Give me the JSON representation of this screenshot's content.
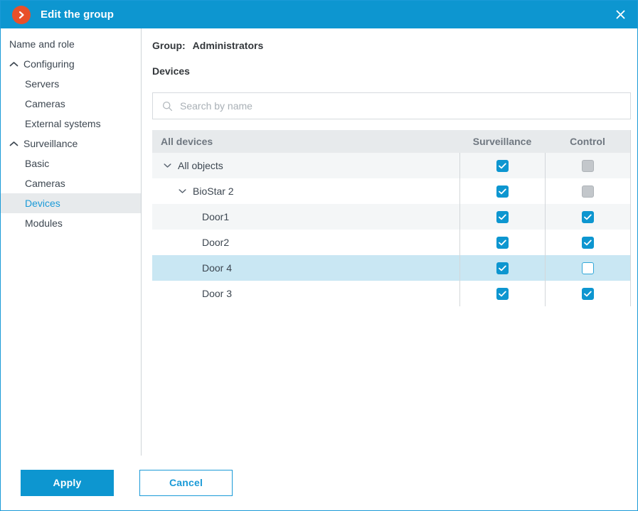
{
  "window": {
    "title": "Edit the group",
    "app_icon": "chevron-right-circle-icon",
    "close_icon": "close-icon",
    "accent_color": "#0d96d0",
    "app_icon_color": "#e8502a"
  },
  "sidebar": {
    "items": [
      {
        "label": "Name and role",
        "type": "item",
        "selected": false,
        "icon": ""
      },
      {
        "label": "Configuring",
        "type": "group",
        "selected": false,
        "icon": "chevron-up-icon"
      },
      {
        "label": "Servers",
        "type": "child",
        "selected": false,
        "icon": ""
      },
      {
        "label": "Cameras",
        "type": "child",
        "selected": false,
        "icon": ""
      },
      {
        "label": "External systems",
        "type": "child",
        "selected": false,
        "icon": ""
      },
      {
        "label": "Surveillance",
        "type": "group",
        "selected": false,
        "icon": "chevron-up-icon"
      },
      {
        "label": "Basic",
        "type": "child",
        "selected": false,
        "icon": ""
      },
      {
        "label": "Cameras",
        "type": "child",
        "selected": false,
        "icon": ""
      },
      {
        "label": "Devices",
        "type": "child",
        "selected": true,
        "icon": ""
      },
      {
        "label": "Modules",
        "type": "child",
        "selected": false,
        "icon": ""
      }
    ]
  },
  "main": {
    "group_label": "Group:",
    "group_name": "Administrators",
    "section_title": "Devices",
    "search": {
      "placeholder": "Search by name",
      "value": "",
      "icon": "search-icon"
    },
    "table": {
      "columns": [
        "All devices",
        "Surveillance",
        "Control"
      ],
      "rows": [
        {
          "label": "All objects",
          "indent": 0,
          "expander": "chevron-down-icon",
          "surveillance": "checked",
          "control": "disabled",
          "row_style": "alt"
        },
        {
          "label": "BioStar 2",
          "indent": 1,
          "expander": "chevron-down-icon",
          "surveillance": "checked",
          "control": "disabled",
          "row_style": "white"
        },
        {
          "label": "Door1",
          "indent": 2,
          "expander": "",
          "surveillance": "checked",
          "control": "checked",
          "row_style": "alt"
        },
        {
          "label": "Door2",
          "indent": 2,
          "expander": "",
          "surveillance": "checked",
          "control": "checked",
          "row_style": "white"
        },
        {
          "label": "Door 4",
          "indent": 2,
          "expander": "",
          "surveillance": "checked",
          "control": "unchecked",
          "row_style": "selected"
        },
        {
          "label": "Door 3",
          "indent": 2,
          "expander": "",
          "surveillance": "checked",
          "control": "checked",
          "row_style": "white"
        }
      ]
    }
  },
  "footer": {
    "apply_label": "Apply",
    "cancel_label": "Cancel"
  }
}
